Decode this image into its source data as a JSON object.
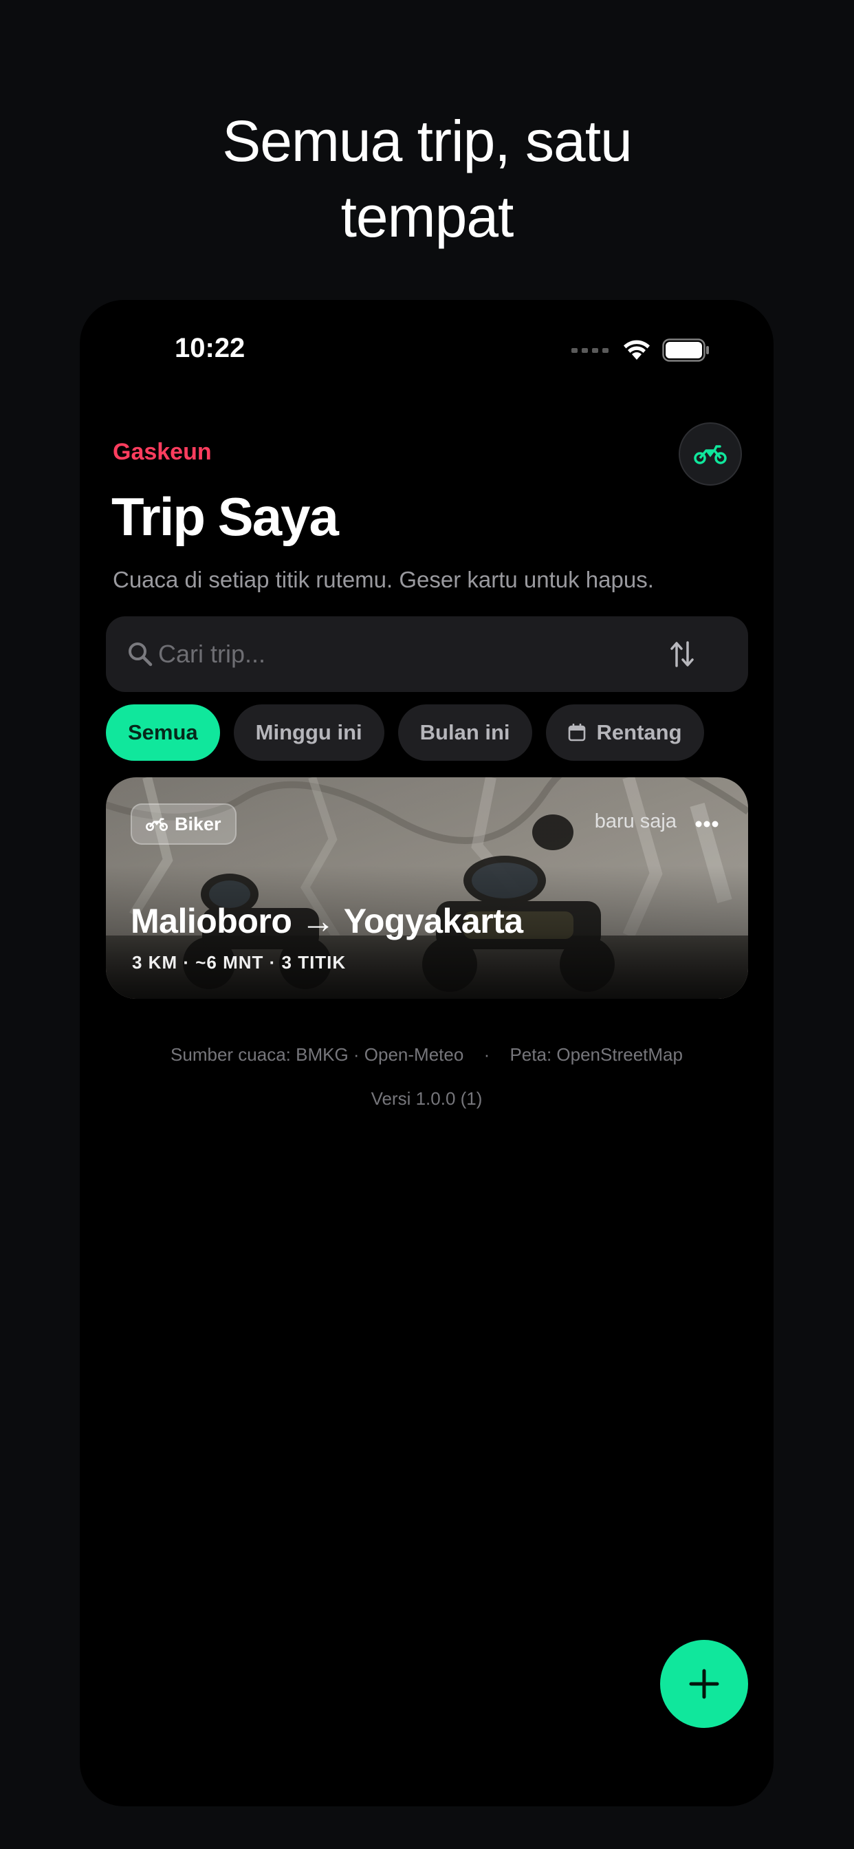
{
  "headline": {
    "line1": "Semua trip, satu",
    "line2": "tempat"
  },
  "status_bar": {
    "time": "10:22",
    "icons": [
      "cellular-signal-icon",
      "wifi-icon",
      "battery-icon"
    ]
  },
  "header": {
    "brand": "Gaskeun",
    "title": "Trip Saya",
    "subtitle": "Cuaca di setiap titik rutemu. Geser kartu untuk hapus.",
    "profile_icon": "motorcycle-icon"
  },
  "search": {
    "placeholder": "Cari trip...",
    "icon": "search-icon",
    "sort_icon": "sort-icon"
  },
  "filters": [
    {
      "label": "Semua",
      "active": true
    },
    {
      "label": "Minggu ini",
      "active": false
    },
    {
      "label": "Bulan ini",
      "active": false
    },
    {
      "label": "Rentang",
      "active": false,
      "icon": "calendar-icon"
    }
  ],
  "trips": [
    {
      "tag": "Biker",
      "tag_icon": "motorcycle-icon",
      "time_ago": "baru saja",
      "title": "Malioboro → Yogyakarta",
      "meta": "3 KM · ~6 MNT · 3 TITIK"
    }
  ],
  "footer": {
    "weather_source": "Sumber cuaca: BMKG · Open-Meteo",
    "separator": "·",
    "map_source": "Peta: OpenStreetMap",
    "version": "Versi 1.0.0 (1)"
  },
  "fab": {
    "icon": "plus-icon"
  },
  "colors": {
    "accent": "#10e79c",
    "brand": "#ff3d5e",
    "background": "#000000"
  }
}
